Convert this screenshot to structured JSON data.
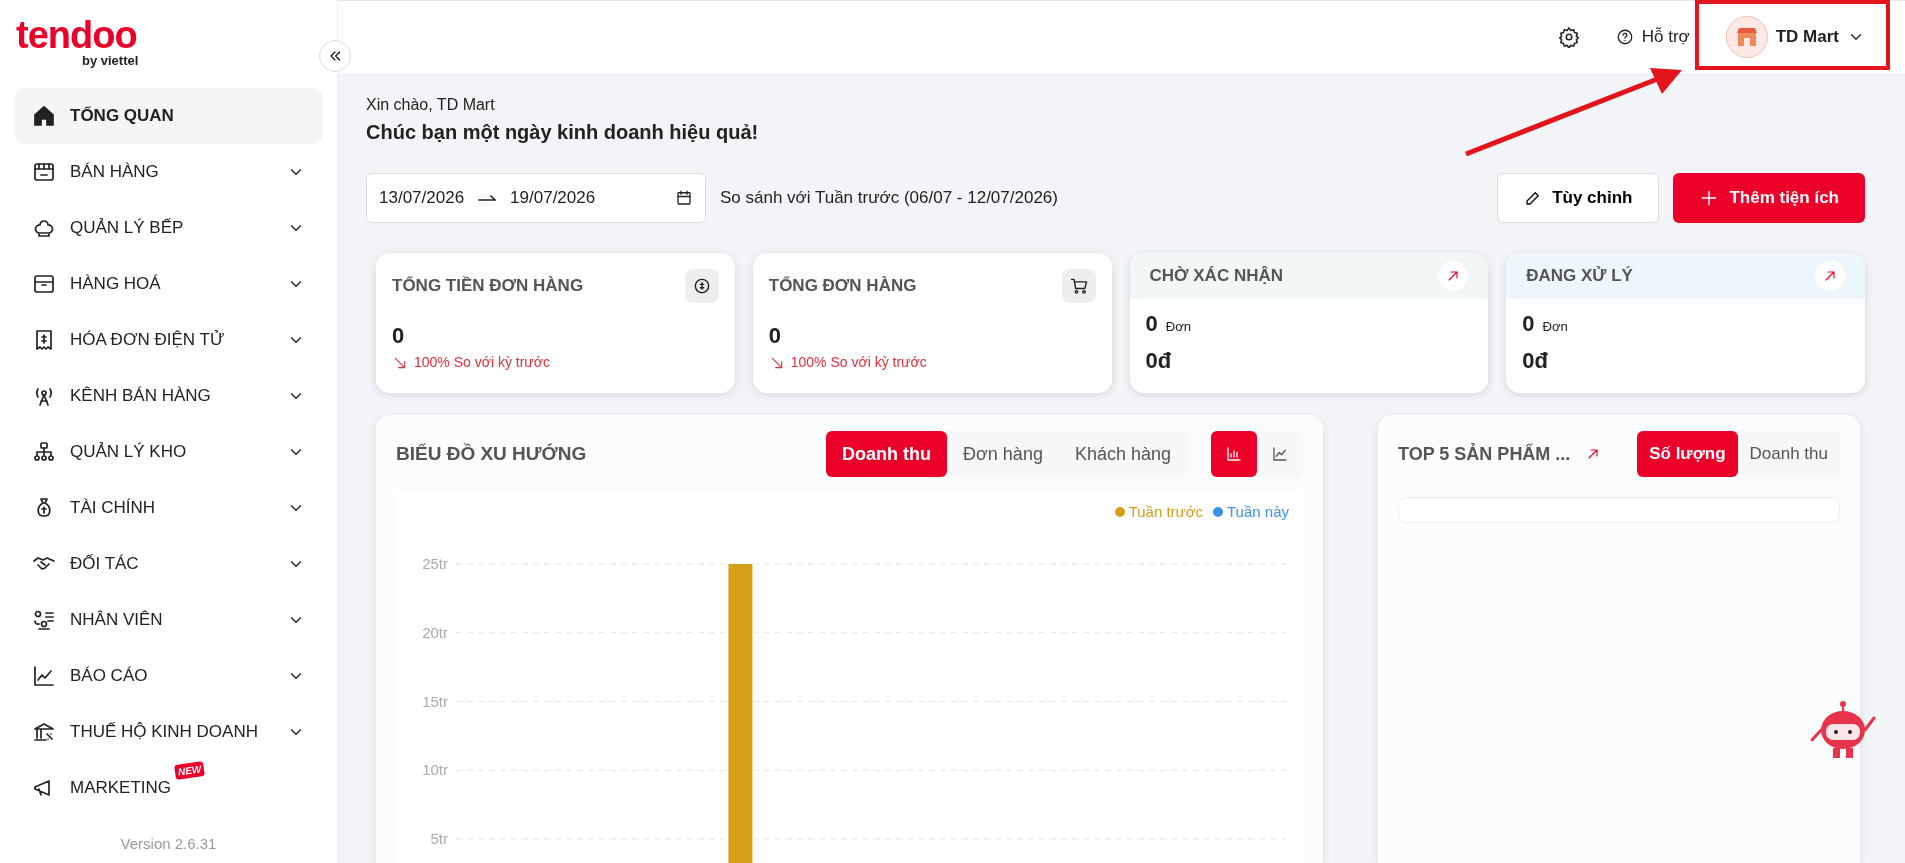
{
  "logo": {
    "name": "tendoo",
    "tagline": "by viettel"
  },
  "sidebar": {
    "items": [
      {
        "label": "TỔNG QUAN",
        "selected": true,
        "expandable": false
      },
      {
        "label": "BÁN HÀNG",
        "selected": false,
        "expandable": true
      },
      {
        "label": "QUẢN LÝ BẾP",
        "selected": false,
        "expandable": true
      },
      {
        "label": "HÀNG HOÁ",
        "selected": false,
        "expandable": true
      },
      {
        "label": "HÓA ĐƠN ĐIỆN TỬ",
        "selected": false,
        "expandable": true
      },
      {
        "label": "KÊNH BÁN HÀNG",
        "selected": false,
        "expandable": true
      },
      {
        "label": "QUẢN LÝ KHO",
        "selected": false,
        "expandable": true
      },
      {
        "label": "TÀI CHÍNH",
        "selected": false,
        "expandable": true
      },
      {
        "label": "ĐỐI TÁC",
        "selected": false,
        "expandable": true
      },
      {
        "label": "NHÂN VIÊN",
        "selected": false,
        "expandable": true
      },
      {
        "label": "BÁO CÁO",
        "selected": false,
        "expandable": true
      },
      {
        "label": "THUẾ HỘ KINH DOANH",
        "selected": false,
        "expandable": true
      },
      {
        "label": "MARKETING",
        "selected": false,
        "expandable": false,
        "badge": "NEW"
      }
    ],
    "version": "Version 2.6.31"
  },
  "header": {
    "help": "Hỗ trợ",
    "user": "TD Mart"
  },
  "greeting": {
    "hello": "Xin chào, TD Mart",
    "message": "Chúc bạn một ngày kinh doanh hiệu quả!"
  },
  "date_range": {
    "start": "13/07/2026",
    "end": "19/07/2026",
    "compare": "So sánh với Tuần trước (06/07 - 12/07/2026)"
  },
  "buttons": [
    {
      "label": "Tùy chỉnh",
      "kind": "outline"
    },
    {
      "label": "Thêm tiện ích",
      "kind": "primary"
    }
  ],
  "cards": [
    {
      "kind": "metric",
      "title": "TỔNG TIỀN ĐƠN HÀNG",
      "value": "0",
      "trend": "100% So với kỳ trước"
    },
    {
      "kind": "metric",
      "title": "TỔNG ĐƠN HÀNG",
      "value": "0",
      "trend": "100% So với kỳ trước"
    },
    {
      "kind": "status",
      "title": "CHỜ XÁC NHẬN",
      "count": "0",
      "unit": "Đơn",
      "amount": "0đ"
    },
    {
      "kind": "status",
      "title": "ĐANG XỬ LÝ",
      "count": "0",
      "unit": "Đơn",
      "amount": "0đ"
    }
  ],
  "trend_chart": {
    "title": "BIỂU ĐỒ XU HƯỚNG",
    "tabs": [
      {
        "label": "Doanh thu",
        "selected": true
      },
      {
        "label": "Đơn hàng",
        "selected": false
      },
      {
        "label": "Khách hàng",
        "selected": false
      }
    ],
    "chart_types": [
      {
        "kind": "bar",
        "selected": true
      },
      {
        "kind": "line",
        "selected": false
      }
    ],
    "chart_data": {
      "type": "bar",
      "ylim": [
        0,
        25
      ],
      "grid": true,
      "yticks": [
        {
          "value": 5,
          "label": "5tr"
        },
        {
          "value": 10,
          "label": "10tr"
        },
        {
          "value": 15,
          "label": "15tr"
        },
        {
          "value": 20,
          "label": "20tr"
        },
        {
          "value": 25,
          "label": "25tr"
        }
      ],
      "series": [
        {
          "name": "Tuần trước",
          "color": "#d4a017",
          "values": [
            0,
            0,
            25,
            0,
            0,
            0,
            0
          ]
        },
        {
          "name": "Tuần này",
          "color": "#3d93e8",
          "values": [
            0,
            0,
            0,
            0,
            0,
            0,
            0
          ]
        }
      ]
    }
  },
  "top_products": {
    "title": "TOP 5 SẢN PHẨM ...",
    "tabs": [
      {
        "label": "Số lượng",
        "selected": true
      },
      {
        "label": "Doanh thu",
        "selected": false
      }
    ]
  }
}
